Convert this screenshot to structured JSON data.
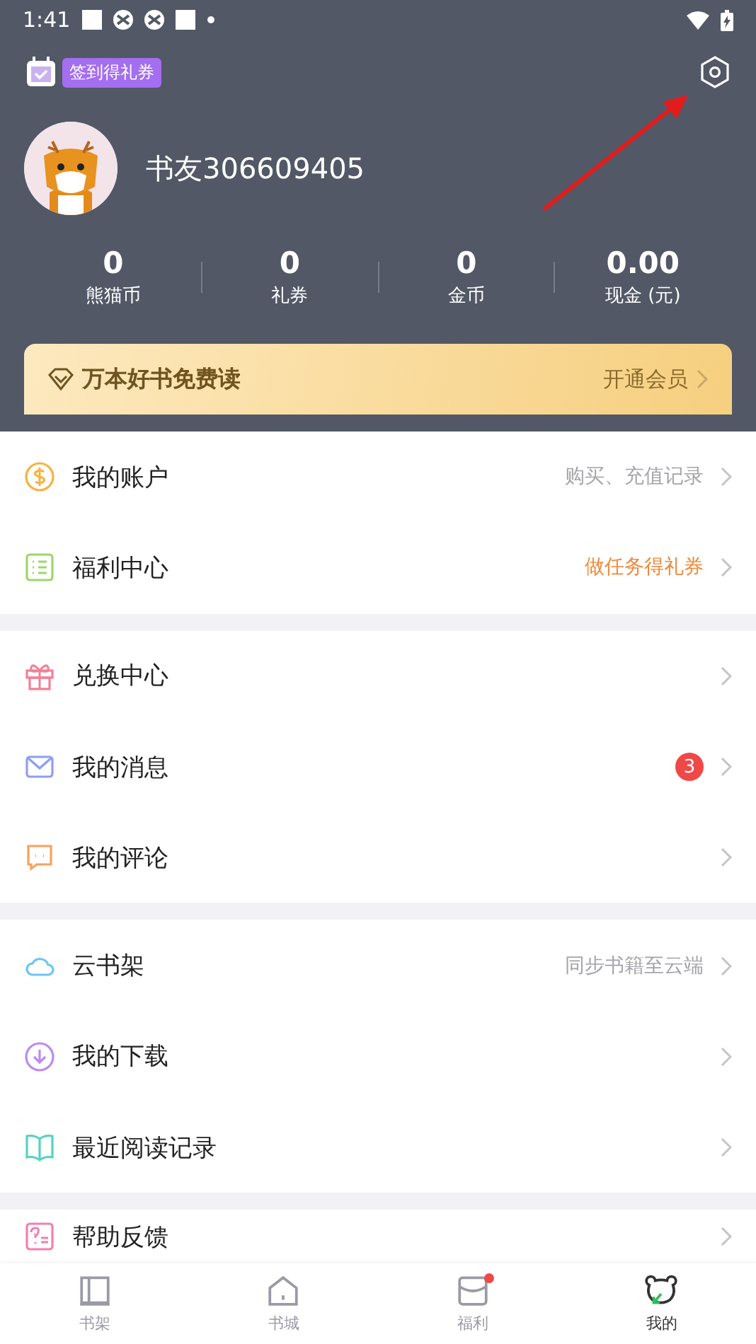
{
  "status_bar": {
    "time": "1:41"
  },
  "checkin": {
    "label": "签到得礼券"
  },
  "profile": {
    "username": "书友306609405"
  },
  "stats": [
    {
      "value": "0",
      "label": "熊猫币"
    },
    {
      "value": "0",
      "label": "礼券"
    },
    {
      "value": "0",
      "label": "金币"
    },
    {
      "value": "0.00",
      "label": "现金 (元)"
    }
  ],
  "vip_banner": {
    "title": "万本好书免费读",
    "action": "开通会员"
  },
  "sections": [
    {
      "items": [
        {
          "label": "我的账户",
          "note": "购买、充值记录",
          "highlight": false
        },
        {
          "label": "福利中心",
          "note": "做任务得礼券",
          "highlight": true
        }
      ]
    },
    {
      "items": [
        {
          "label": "兑换中心"
        },
        {
          "label": "我的消息",
          "badge": "3"
        },
        {
          "label": "我的评论"
        }
      ]
    },
    {
      "items": [
        {
          "label": "云书架",
          "note": "同步书籍至云端",
          "highlight": false
        },
        {
          "label": "我的下载"
        },
        {
          "label": "最近阅读记录"
        }
      ]
    },
    {
      "items": [
        {
          "label": "帮助反馈"
        }
      ]
    }
  ],
  "bottom_nav": [
    {
      "label": "书架",
      "selected": false,
      "dot": false
    },
    {
      "label": "书城",
      "selected": false,
      "dot": false
    },
    {
      "label": "福利",
      "selected": false,
      "dot": true
    },
    {
      "label": "我的",
      "selected": true,
      "dot": false
    }
  ]
}
